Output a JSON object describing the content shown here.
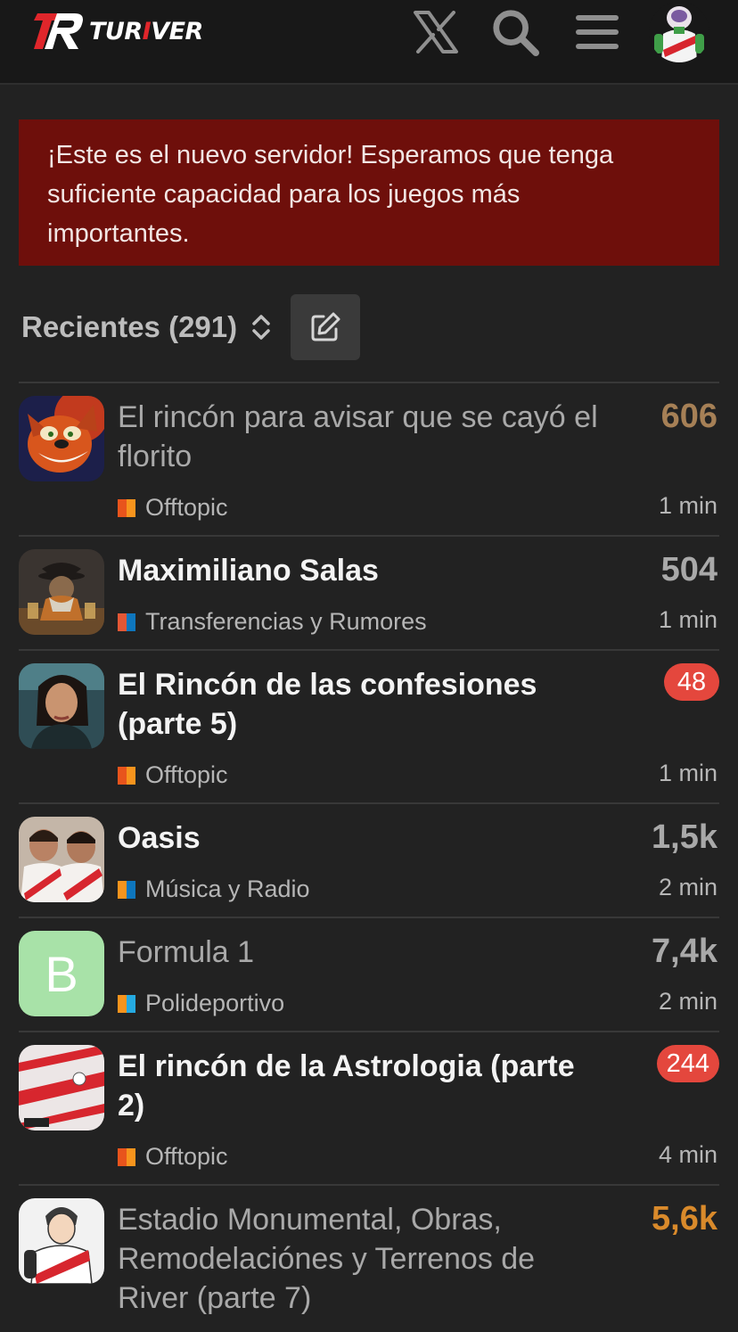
{
  "header": {
    "brand_prefix": "TUR",
    "brand_accent": "I",
    "brand_suffix": "VER",
    "icons": [
      "x-logo-icon",
      "search-icon",
      "hamburger-menu-icon",
      "user-avatar"
    ]
  },
  "banner": {
    "text": "¡Este es el nuevo servidor! Esperamos que tenga suficiente capacidad para los juegos más importantes."
  },
  "list": {
    "title": "Recientes (291)",
    "sort_icon": "chevron-up-down-icon",
    "new_topic_icon": "pencil-square-icon"
  },
  "topics": [
    {
      "title": "El rincón para avisar que se cayó el florito",
      "category": "Offtopic",
      "count": "606",
      "badge": "",
      "time": "1 min"
    },
    {
      "title": "Maximiliano Salas",
      "category": "Transferencias y Rumores",
      "count": "504",
      "badge": "",
      "time": "1 min"
    },
    {
      "title": "El Rincón de las confesiones (parte 5)",
      "category": "Offtopic",
      "count": "",
      "badge": "48",
      "time": "1 min"
    },
    {
      "title": "Oasis",
      "category": "Música y Radio",
      "count": "1,5k",
      "badge": "",
      "time": "2 min"
    },
    {
      "title": "Formula 1",
      "category": "Polideportivo",
      "count": "7,4k",
      "badge": "",
      "time": "2 min",
      "avatar_letter": "B"
    },
    {
      "title": "El rincón de la Astrologia (parte 2)",
      "category": "Offtopic",
      "count": "",
      "badge": "244",
      "time": "4 min"
    },
    {
      "title": "Estadio Monumental, Obras, Remodelaciónes y Terrenos de River (parte 7)",
      "category": "",
      "count": "5,6k",
      "badge": "",
      "time": ""
    }
  ],
  "colors": {
    "header_bg": "#181818",
    "page_bg": "#222222",
    "banner_bg": "#6e0f0b",
    "badge_bg": "#e4473d",
    "offtopic": [
      "#e8541c",
      "#f7941d"
    ],
    "transferencias": [
      "#e45735",
      "#0e76bd"
    ],
    "musica": [
      "#f7941d",
      "#0e76bd"
    ],
    "polideportivo": [
      "#f7941d",
      "#25aae1"
    ]
  }
}
